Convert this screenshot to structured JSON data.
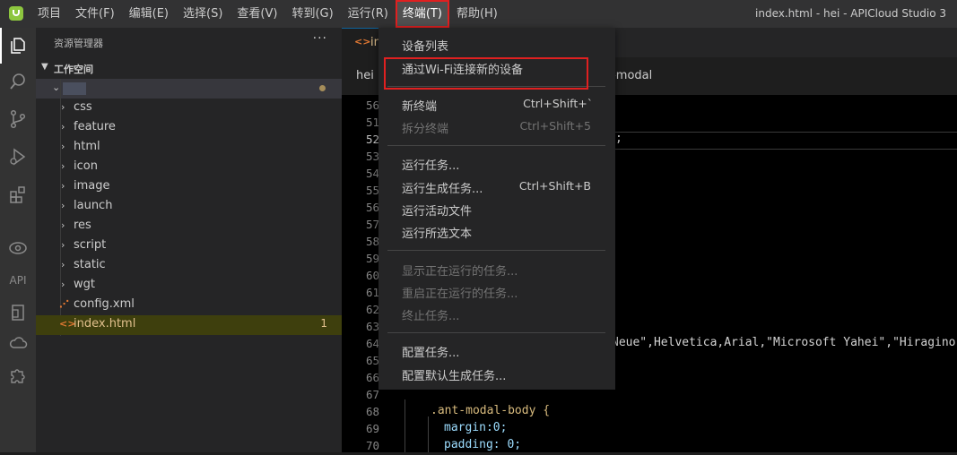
{
  "menubar": {
    "items": [
      "项目",
      "文件(F)",
      "编辑(E)",
      "选择(S)",
      "查看(V)",
      "转到(G)",
      "运行(R)",
      "终端(T)",
      "帮助(H)"
    ],
    "open_index": 7
  },
  "window_title": "index.html - hei - APICloud Studio 3",
  "activitybar": {
    "items": [
      {
        "name": "explorer-icon",
        "active": true
      },
      {
        "name": "search-icon"
      },
      {
        "name": "source-control-icon"
      },
      {
        "name": "run-debug-icon"
      },
      {
        "name": "extensions-icon"
      },
      {
        "name": "preview-eye-icon"
      },
      {
        "name": "api-icon",
        "text": "API"
      },
      {
        "name": "device-icon"
      },
      {
        "name": "cloud-icon"
      },
      {
        "name": "plugin-puzzle-icon"
      }
    ]
  },
  "sidebar": {
    "title": "资源管理器",
    "more": "···",
    "workspace": "工作空间",
    "items": [
      {
        "label": "css",
        "type": "folder"
      },
      {
        "label": "feature",
        "type": "folder"
      },
      {
        "label": "html",
        "type": "folder"
      },
      {
        "label": "icon",
        "type": "folder"
      },
      {
        "label": "image",
        "type": "folder"
      },
      {
        "label": "launch",
        "type": "folder"
      },
      {
        "label": "res",
        "type": "folder"
      },
      {
        "label": "script",
        "type": "folder"
      },
      {
        "label": "static",
        "type": "folder"
      },
      {
        "label": "wgt",
        "type": "folder"
      },
      {
        "label": "config.xml",
        "type": "xml"
      },
      {
        "label": "index.html",
        "type": "html",
        "badge": "1",
        "modified": true
      }
    ]
  },
  "editor": {
    "tab_label": "in",
    "breadcrumb_root": "hei",
    "breadcrumb_tail": "t-modal",
    "line_numbers": [
      "56",
      "51",
      "52",
      "53",
      "54",
      "55",
      "56",
      "57",
      "58",
      "59",
      "60",
      "61",
      "62",
      "63",
      "64",
      "65",
      "66",
      "67",
      "68",
      "69",
      "70"
    ],
    "current_line": "52",
    "code_lines": [
      {
        "line": "52",
        "text": ";"
      },
      {
        "line": "64",
        "text": "Neue\",Helvetica,Arial,\"Microsoft Yahei\",\"Hiragino S"
      },
      {
        "line": "68",
        "text": ".ant-modal-body {"
      },
      {
        "line": "69",
        "text": "margin:0;"
      },
      {
        "line": "70",
        "text": "padding: 0;"
      }
    ]
  },
  "terminal_menu": {
    "items": [
      {
        "label": "设备列表"
      },
      {
        "label": "通过Wi-Fi连接新的设备"
      },
      {
        "separator": true
      },
      {
        "label": "新终端",
        "shortcut": "Ctrl+Shift+`"
      },
      {
        "label": "拆分终端",
        "shortcut": "Ctrl+Shift+5",
        "disabled": true
      },
      {
        "separator": true
      },
      {
        "label": "运行任务..."
      },
      {
        "label": "运行生成任务...",
        "shortcut": "Ctrl+Shift+B"
      },
      {
        "label": "运行活动文件"
      },
      {
        "label": "运行所选文本"
      },
      {
        "separator": true
      },
      {
        "label": "显示正在运行的任务...",
        "disabled": true
      },
      {
        "label": "重启正在运行的任务...",
        "disabled": true
      },
      {
        "label": "终止任务...",
        "disabled": true
      },
      {
        "separator": true
      },
      {
        "label": "配置任务..."
      },
      {
        "label": "配置默认生成任务..."
      }
    ]
  },
  "colors": {
    "highlight_red": "#e02020",
    "modified_text": "#e2c08d",
    "menu_bg": "#252526"
  }
}
